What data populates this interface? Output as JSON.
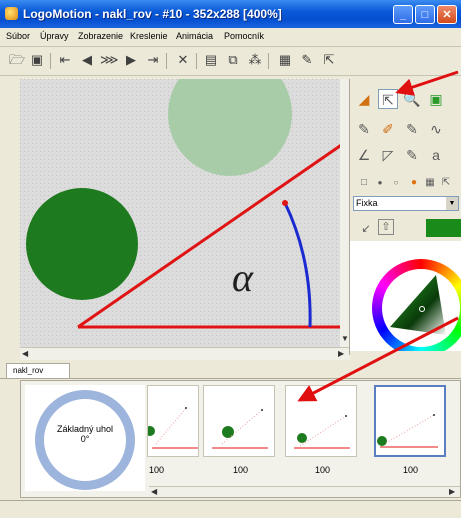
{
  "window": {
    "title": "LogoMotion - nakl_rov - #10 - 352x288 [400%]"
  },
  "menu": {
    "items": [
      "Súbor",
      "Úpravy",
      "Zobrazenie",
      "Kreslenie",
      "Animácia",
      "Pomocník"
    ]
  },
  "canvas": {
    "alpha_label": "α"
  },
  "right_panel": {
    "pen_type": "Fixka"
  },
  "tab": {
    "label": "nakl_rov"
  },
  "timeline": {
    "first_frame_title": "Základný uhol",
    "first_frame_angle": "0°",
    "frame_labels": [
      "100",
      "100",
      "100",
      "100"
    ]
  },
  "colors": {
    "accent_red": "#e01414",
    "circle_green": "#1e7a1e",
    "circle_light": "#a8cca8",
    "arc_blue": "#1a2ad0",
    "fill_green": "#1a8a1a"
  }
}
